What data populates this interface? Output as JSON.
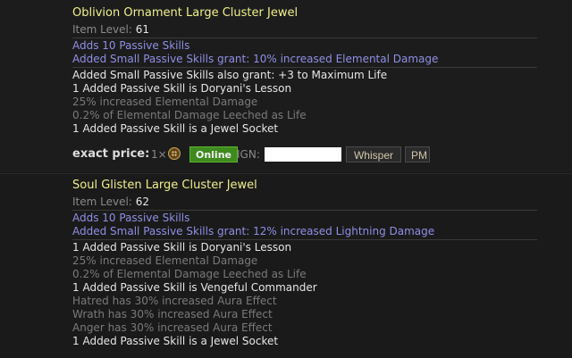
{
  "listings": [
    {
      "name": "Oblivion Ornament Large Cluster Jewel",
      "item_level_label": "Item Level:",
      "item_level": "61",
      "enchants": [
        "Adds 10 Passive Skills",
        "Added Small Passive Skills grant: 10% increased Elemental Damage"
      ],
      "mods": [
        {
          "text": "Added Small Passive Skills also grant: +3 to Maximum Life",
          "style": "white"
        },
        {
          "text": "1 Added Passive Skill is Doryani's Lesson",
          "style": "white"
        },
        {
          "text": "25% increased Elemental Damage",
          "style": "gray"
        },
        {
          "text": "0.2% of Elemental Damage Leeched as Life",
          "style": "gray"
        },
        {
          "text": "1 Added Passive Skill is a Jewel Socket",
          "style": "white"
        }
      ],
      "price": {
        "label": "exact price:",
        "quantity": "1×",
        "currency_icon": "currency-orb-icon",
        "status": "Online",
        "ign_label": "IGN:",
        "whisper_label": "Whisper",
        "pm_label": "PM"
      }
    },
    {
      "name": "Soul Glisten Large Cluster Jewel",
      "item_level_label": "Item Level:",
      "item_level": "62",
      "enchants": [
        "Adds 10 Passive Skills",
        "Added Small Passive Skills grant: 12% increased Lightning Damage"
      ],
      "mods": [
        {
          "text": "1 Added Passive Skill is Doryani's Lesson",
          "style": "white"
        },
        {
          "text": "25% increased Elemental Damage",
          "style": "gray"
        },
        {
          "text": "0.2% of Elemental Damage Leeched as Life",
          "style": "gray"
        },
        {
          "text": "1 Added Passive Skill is Vengeful Commander",
          "style": "white"
        },
        {
          "text": "Hatred has 30% increased Aura Effect",
          "style": "gray"
        },
        {
          "text": "Wrath has 30% increased Aura Effect",
          "style": "gray"
        },
        {
          "text": "Anger has 30% increased Aura Effect",
          "style": "gray"
        },
        {
          "text": "1 Added Passive Skill is a Jewel Socket",
          "style": "white"
        }
      ]
    }
  ],
  "colors": {
    "title": "#f1ef8a",
    "enchant": "#8f8fe6",
    "mod": "#e6e6e6",
    "muted": "#7a7a7a",
    "online": "#3e8a1e"
  }
}
